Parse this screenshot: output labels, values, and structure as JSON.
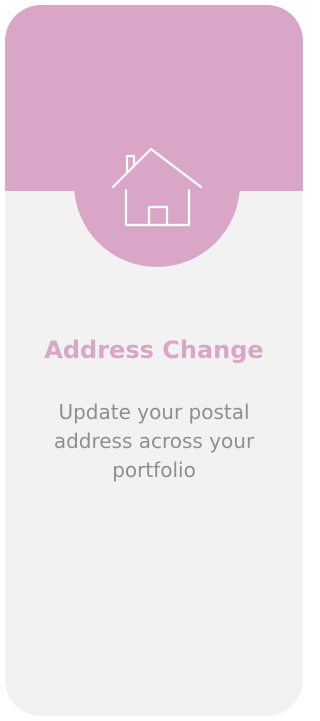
{
  "card": {
    "icon": "home-icon",
    "title": "Address Change",
    "description": "Update your postal address across your portfolio"
  },
  "colors": {
    "accent": "#d9a6c8",
    "background": "#f2f2f2",
    "text": "#8f8f8f",
    "icon_stroke": "#ffffff"
  }
}
